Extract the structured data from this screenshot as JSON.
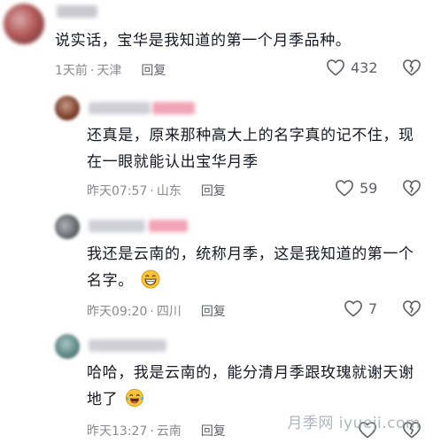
{
  "comments": [
    {
      "text": "说实话，宝华是我知道的第一个月季品种。",
      "time": "1天前",
      "location": "天津",
      "reply_label": "回复",
      "likes": "432"
    },
    {
      "text": "还真是，原来那种高大上的名字真的记不住，现在一眼就能认出宝华月季",
      "time": "昨天07:57",
      "location": "山东",
      "reply_label": "回复",
      "likes": "59"
    },
    {
      "text": "我还是云南的，统称月季，这是我知道的第一个名字。",
      "time": "昨天09:20",
      "location": "四川",
      "reply_label": "回复",
      "likes": "7"
    },
    {
      "text": "哈哈，我是云南的，能分清月季跟玫瑰就谢天谢地了",
      "time": "昨天13:27",
      "location": "云南",
      "reply_label": "回复",
      "likes": ""
    }
  ],
  "watermark": "月季网 iyueji.com",
  "colors": {
    "text": "#161823",
    "meta": "#8a8b91",
    "icon": "#5f6068",
    "heart_pink": "#f26d8a",
    "emoji_yellow": "#f8c43a"
  },
  "icons": {
    "like": "heart-outline-icon",
    "dislike": "broken-heart-icon",
    "emoji_grin": "grinning-face-icon",
    "emoji_laugh": "tears-of-joy-face-icon"
  }
}
